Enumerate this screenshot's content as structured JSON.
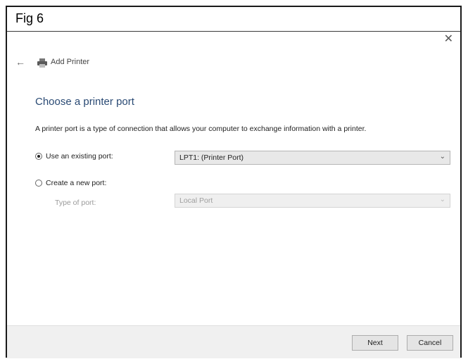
{
  "figure": {
    "label": "Fig 6"
  },
  "window": {
    "title": "Add Printer",
    "close_glyph": "✕",
    "back_glyph": "←"
  },
  "page": {
    "heading": "Choose a printer port",
    "description": "A printer port is a type of connection that allows your computer to exchange information with a printer."
  },
  "options": {
    "existing": {
      "label": "Use an existing port:",
      "selected": true,
      "value": "LPT1: (Printer Port)"
    },
    "new": {
      "label": "Create a new port:",
      "selected": false,
      "type_label": "Type of port:",
      "value": "Local Port"
    }
  },
  "buttons": {
    "next": "Next",
    "cancel": "Cancel"
  },
  "icons": {
    "back": "back-arrow-icon",
    "printer": "printer-icon",
    "close": "close-icon",
    "dropdown": "chevron-down-icon"
  }
}
